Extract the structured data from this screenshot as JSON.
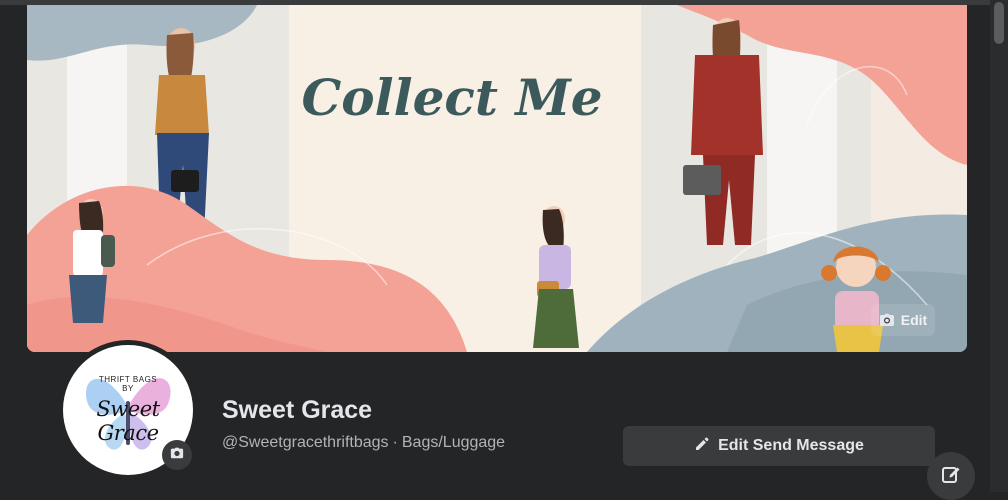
{
  "cover": {
    "headline": "Collect Me",
    "edit_label": "Edit",
    "icon": "camera-icon"
  },
  "avatar": {
    "top_line1": "THRIFT BAGS",
    "top_line2": "BY",
    "script_name": "Sweet Grace",
    "camera_icon": "camera-icon"
  },
  "profile": {
    "name": "Sweet Grace",
    "handle": "@Sweetgracethriftbags",
    "category": "Bags/Luggage"
  },
  "actions": {
    "primary_label": "Edit Send Message",
    "primary_icon": "pencil-icon",
    "fab_icon": "compose-icon"
  },
  "colors": {
    "background": "#242526",
    "button": "#3a3b3c",
    "text_primary": "#e4e6eb",
    "text_secondary": "#b0b3b8",
    "cover_peach": "#f4a196",
    "cover_blue_gray": "#9fb2bd",
    "cover_cream": "#f7efe6"
  }
}
